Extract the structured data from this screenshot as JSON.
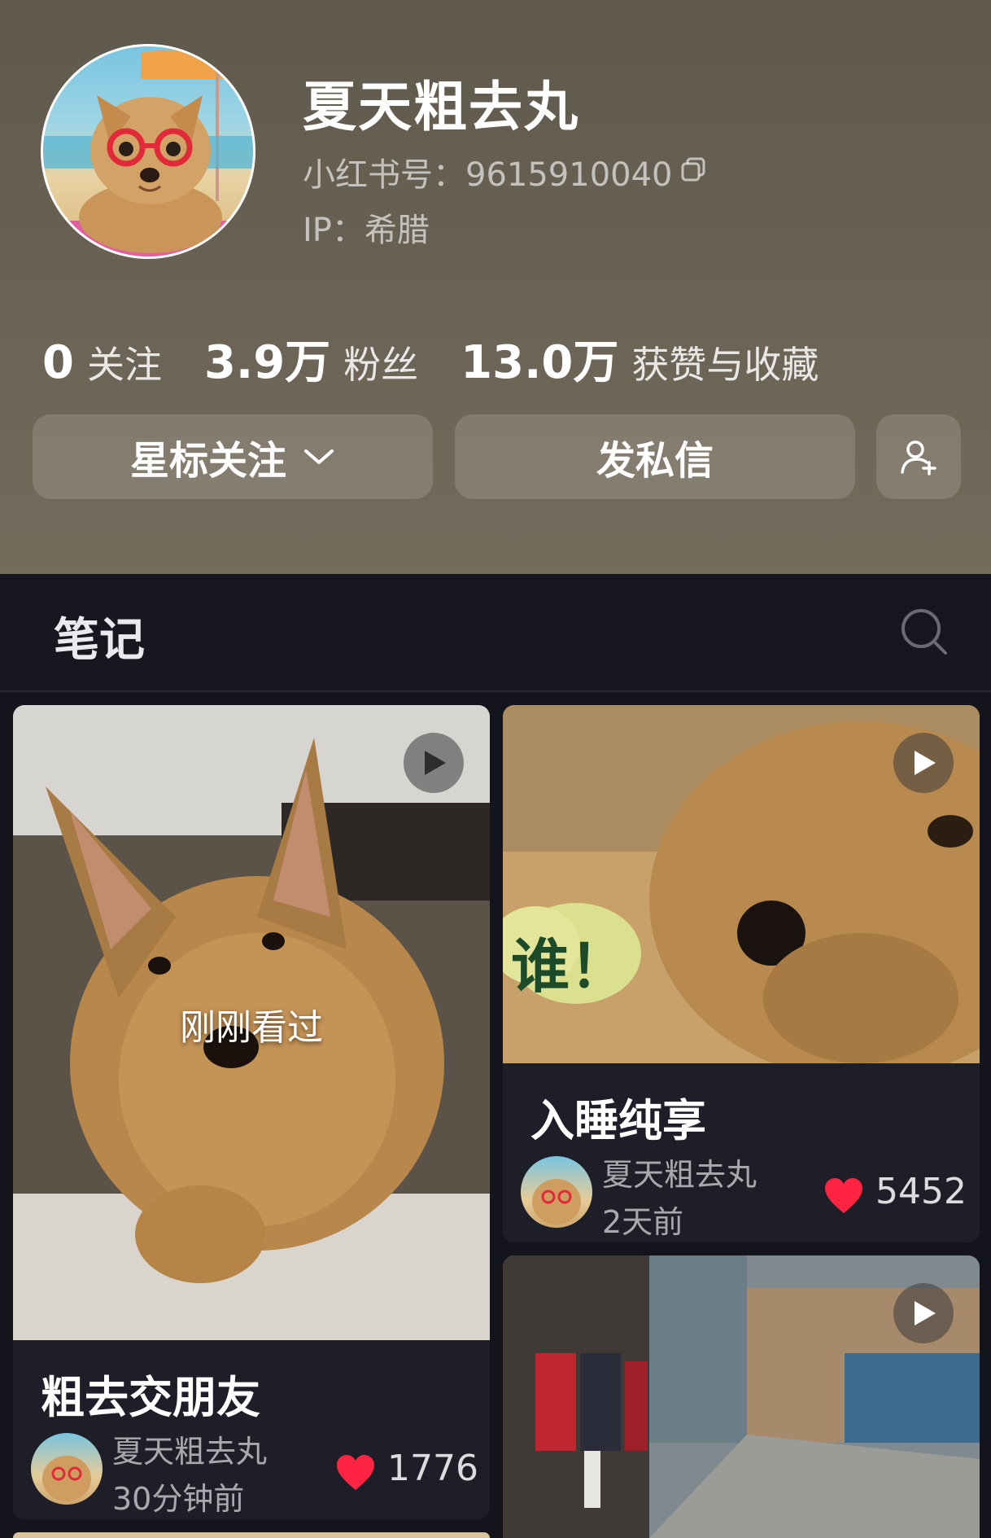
{
  "profile": {
    "username": "夏天粗去丸",
    "id_line": "小红书号：9615910040",
    "ip_line": "IP：希腊",
    "stats": [
      {
        "num": "0",
        "label": "关注"
      },
      {
        "num": "3.9万",
        "label": "粉丝"
      },
      {
        "num": "13.0万",
        "label": "获赞与收藏"
      }
    ],
    "buttons": {
      "star_follow": "星标关注",
      "message": "发私信"
    }
  },
  "tabs": {
    "notes": "笔记"
  },
  "feed": [
    {
      "title": "粗去交朋友",
      "overlay": "刚刚看过",
      "author": "夏天粗去丸",
      "time": "30分钟前",
      "likes": "1776",
      "is_video": true
    },
    {
      "title": "入睡纯享",
      "sticker_text": "谁！",
      "author": "夏天粗去丸",
      "time": "2天前",
      "likes": "5452",
      "is_video": true
    },
    {
      "title": "",
      "is_video": true
    }
  ],
  "colors": {
    "header_bg": "#6a6353",
    "page_bg": "#14141c",
    "heart": "#ff2442"
  },
  "icons": [
    "copy-icon",
    "chevron-down-icon",
    "add-friend-icon",
    "search-icon",
    "play-icon",
    "heart-icon"
  ]
}
